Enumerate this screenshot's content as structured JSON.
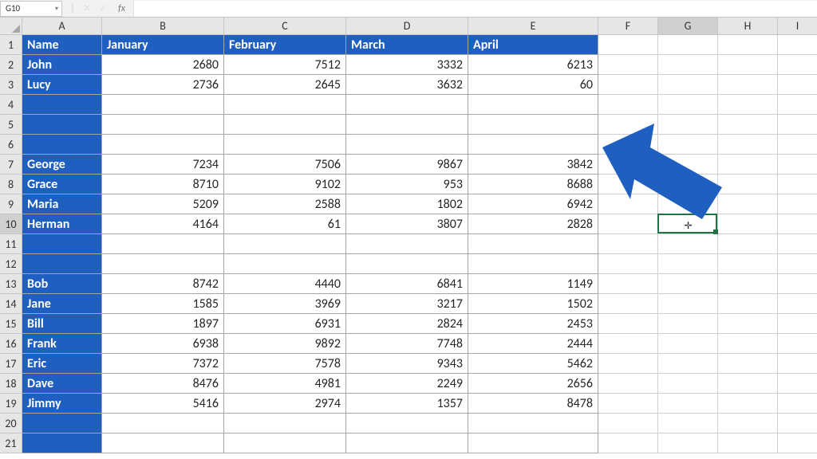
{
  "name_box": "G10",
  "formula_bar_value": "",
  "fx_label": "fx",
  "columns": [
    "A",
    "B",
    "C",
    "D",
    "E",
    "F",
    "G",
    "H",
    "I"
  ],
  "col_widths": [
    "cw-A",
    "cw-B",
    "cw-C",
    "cw-D",
    "cw-E",
    "cw-F",
    "cw-G",
    "cw-H",
    "cw-I"
  ],
  "selected_col_index": 6,
  "selected_row_index": 9,
  "row_count": 21,
  "active_cell": {
    "col": "G",
    "row": 10
  },
  "headers": {
    "A": "Name",
    "B": "January",
    "C": "February",
    "D": "March",
    "E": "April"
  },
  "rows": [
    {
      "name": "John",
      "B": 2680,
      "C": 7512,
      "D": 3332,
      "E": 6213
    },
    {
      "name": "Lucy",
      "B": 2736,
      "C": 2645,
      "D": 3632,
      "E": 60
    },
    {
      "name": "",
      "B": "",
      "C": "",
      "D": "",
      "E": ""
    },
    {
      "name": "",
      "B": "",
      "C": "",
      "D": "",
      "E": ""
    },
    {
      "name": "",
      "B": "",
      "C": "",
      "D": "",
      "E": ""
    },
    {
      "name": "George",
      "B": 7234,
      "C": 7506,
      "D": 9867,
      "E": 3842
    },
    {
      "name": "Grace",
      "B": 8710,
      "C": 9102,
      "D": 953,
      "E": 8688
    },
    {
      "name": "Maria",
      "B": 5209,
      "C": 2588,
      "D": 1802,
      "E": 6942
    },
    {
      "name": "Herman",
      "B": 4164,
      "C": 61,
      "D": 3807,
      "E": 2828
    },
    {
      "name": "",
      "B": "",
      "C": "",
      "D": "",
      "E": ""
    },
    {
      "name": "",
      "B": "",
      "C": "",
      "D": "",
      "E": ""
    },
    {
      "name": "Bob",
      "B": 8742,
      "C": 4440,
      "D": 6841,
      "E": 1149
    },
    {
      "name": "Jane",
      "B": 1585,
      "C": 3969,
      "D": 3217,
      "E": 1502
    },
    {
      "name": "Bill",
      "B": 1897,
      "C": 6931,
      "D": 2824,
      "E": 2453
    },
    {
      "name": "Frank",
      "B": 6938,
      "C": 9892,
      "D": 7748,
      "E": 2444
    },
    {
      "name": "Eric",
      "B": 7372,
      "C": 7578,
      "D": 9343,
      "E": 5462
    },
    {
      "name": "Dave",
      "B": 8476,
      "C": 4981,
      "D": 2249,
      "E": 2656
    },
    {
      "name": "Jimmy",
      "B": 5416,
      "C": 2974,
      "D": 1357,
      "E": 8478
    }
  ],
  "icons": {
    "cancel": "✕",
    "confirm": "✓",
    "chevron": "▾",
    "divider": "│",
    "plus_cursor": "✛"
  },
  "arrow_color": "#1f5fbf"
}
